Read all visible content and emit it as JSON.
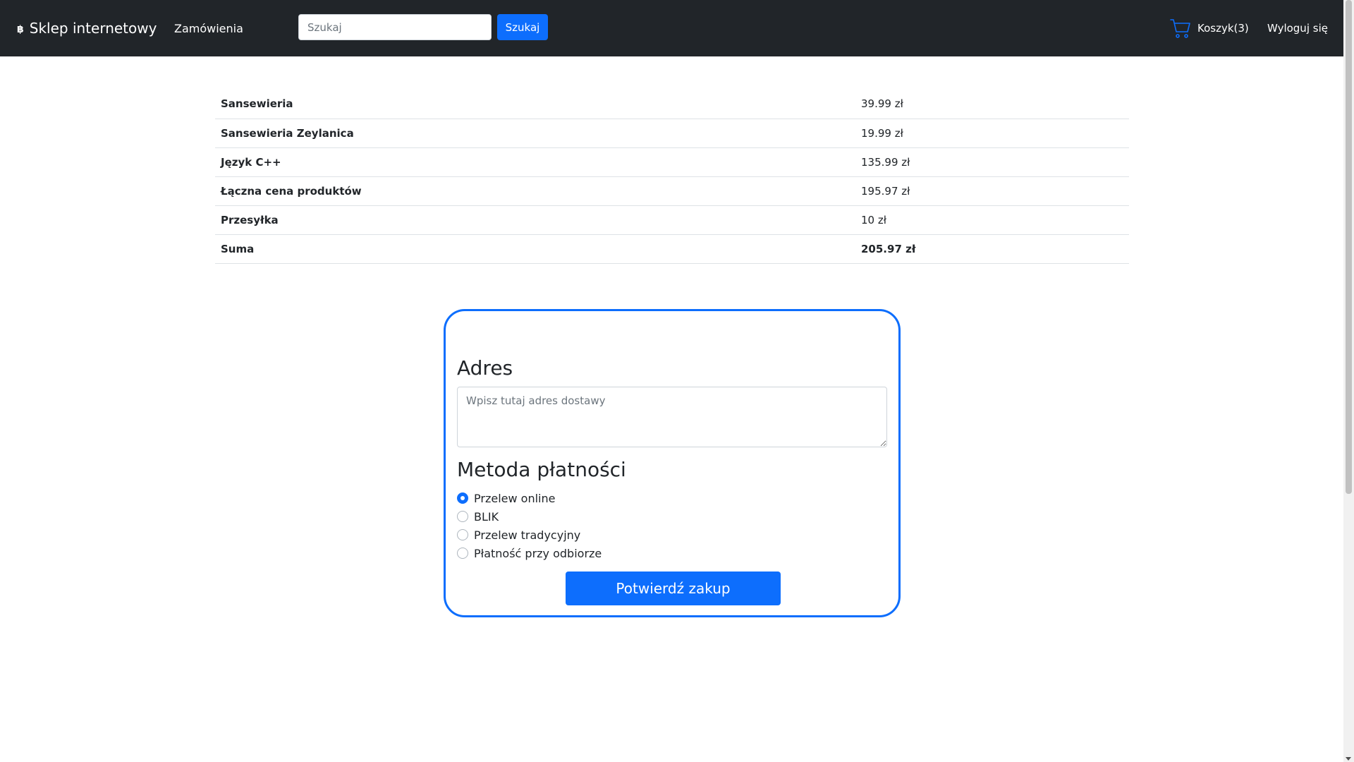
{
  "navbar": {
    "brand_icon": "฿",
    "brand": "Sklep internetowy",
    "orders_link": "Zamówienia",
    "search_placeholder": "Szukaj",
    "search_button": "Szukaj",
    "cart_label": "Koszyk(3)",
    "logout_label": "Wyloguj się",
    "cart_icon": "shopping-cart-icon"
  },
  "order": {
    "rows": [
      {
        "name": "Sansewieria",
        "price": "39.99 zł"
      },
      {
        "name": "Sansewieria Zeylanica",
        "price": "19.99 zł"
      },
      {
        "name": "Język C++",
        "price": "135.99 zł"
      },
      {
        "name": "Łączna cena produktów",
        "price": "195.97 zł"
      },
      {
        "name": "Przesyłka",
        "price": "10 zł"
      },
      {
        "name": "Suma",
        "price": "205.97 zł"
      }
    ]
  },
  "checkout": {
    "address_heading": "Adres",
    "address_placeholder": "Wpisz tutaj adres dostawy",
    "payment_heading": "Metoda płatności",
    "payment_options": [
      {
        "label": "Przelew online",
        "checked": true
      },
      {
        "label": "BLIK",
        "checked": false
      },
      {
        "label": "Przelew tradycyjny",
        "checked": false
      },
      {
        "label": "Płatność przy odbiorze",
        "checked": false
      }
    ],
    "confirm_button": "Potwierdź zakup"
  },
  "colors": {
    "navbar_bg": "#212529",
    "primary": "#0d6efd",
    "cart_icon": "#0d6efd"
  }
}
